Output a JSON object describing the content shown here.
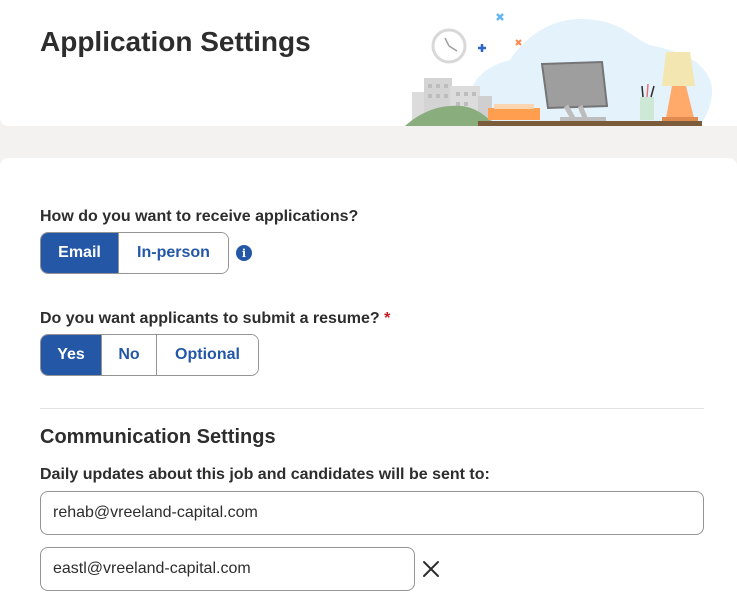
{
  "header": {
    "title": "Application Settings",
    "illustration": "office-desk-illustration"
  },
  "receive": {
    "question": "How do you want to receive applications?",
    "options": [
      "Email",
      "In-person"
    ],
    "selected": "Email",
    "info_icon": "info-icon"
  },
  "resume": {
    "question": "Do you want applicants to submit a resume?",
    "required_marker": "*",
    "options": [
      "Yes",
      "No",
      "Optional"
    ],
    "selected": "Yes"
  },
  "communication": {
    "title": "Communication Settings",
    "label": "Daily updates about this job and candidates will be sent to:",
    "emails": [
      "rehab@vreeland-capital.com",
      "eastl@vreeland-capital.com"
    ],
    "remove_icon": "close-icon"
  },
  "colors": {
    "accent": "#2557a7",
    "required": "#c91b22",
    "background": "#f3f2f1"
  }
}
